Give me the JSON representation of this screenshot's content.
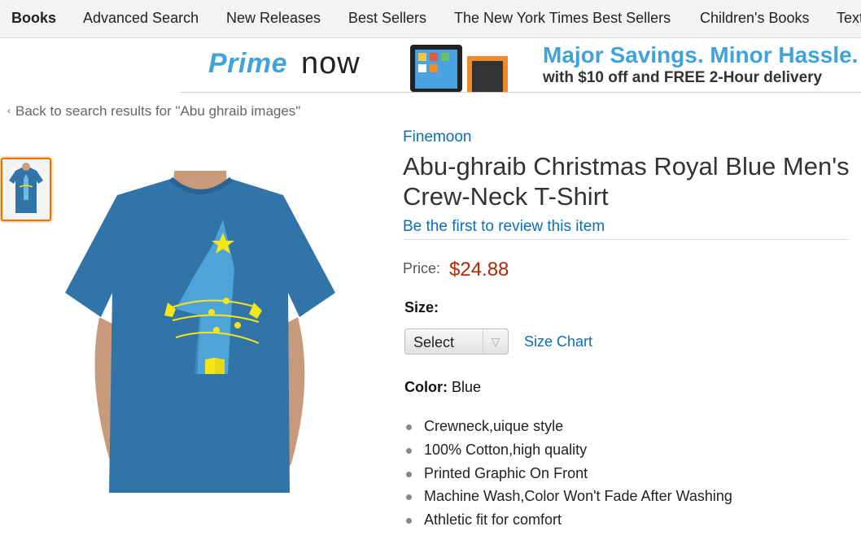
{
  "nav": {
    "items": [
      {
        "label": "Books"
      },
      {
        "label": "Advanced Search"
      },
      {
        "label": "New Releases"
      },
      {
        "label": "Best Sellers"
      },
      {
        "label": "The New York Times Best Sellers"
      },
      {
        "label": "Children's Books"
      },
      {
        "label": "Textbooks"
      }
    ]
  },
  "banner": {
    "logo_prime": "Prime",
    "logo_now": "now",
    "headline": "Major Savings. Minor Hassle.",
    "subline": "with $10 off and FREE 2-Hour delivery"
  },
  "breadcrumb": {
    "back_label": "Back to search results for \"Abu ghraib images\""
  },
  "product": {
    "brand": "Finemoon",
    "title": "Abu-ghraib Christmas Royal Blue Men's Crew-Neck T-Shirt",
    "review_link": "Be the first to review this item",
    "price_label": "Price:",
    "price": "$24.88",
    "size_label": "Size:",
    "size_selected": "Select",
    "size_chart_link": "Size Chart",
    "color_label": "Color:",
    "color_value": "Blue",
    "features": [
      "Crewneck,uique style",
      "100% Cotton,high quality",
      "Printed Graphic On Front",
      "Machine Wash,Color Won't Fade After Washing",
      "Athletic fit for comfort"
    ]
  },
  "colors": {
    "link": "#0b6fb3",
    "price": "#b12704",
    "shirt": "#3174a8",
    "graphic": "#f5e61a",
    "thumb_border": "#e77600"
  }
}
